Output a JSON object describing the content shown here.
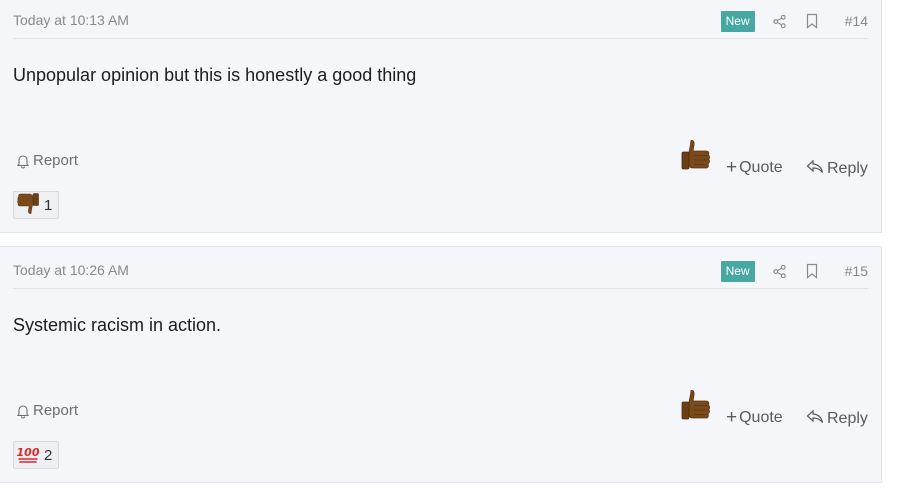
{
  "posts": [
    {
      "timestamp": "Today at 10:13 AM",
      "badge": "New",
      "number": "#14",
      "body": "Unpopular opinion but this is honestly a good thing",
      "report_label": "Report",
      "quote_label": "Quote",
      "reply_label": "Reply",
      "reaction": {
        "icon": "thumbs-down-icon",
        "count": "1"
      }
    },
    {
      "timestamp": "Today at 10:26 AM",
      "badge": "New",
      "number": "#15",
      "body": "Systemic racism in action.",
      "report_label": "Report",
      "quote_label": "Quote",
      "reply_label": "Reply",
      "reaction": {
        "icon": "hundred-points-icon",
        "count": "2"
      }
    }
  ],
  "colors": {
    "badge_bg": "#47a7a3",
    "post_bg": "#f5f6fa",
    "meta_text": "#8a8a8a"
  }
}
